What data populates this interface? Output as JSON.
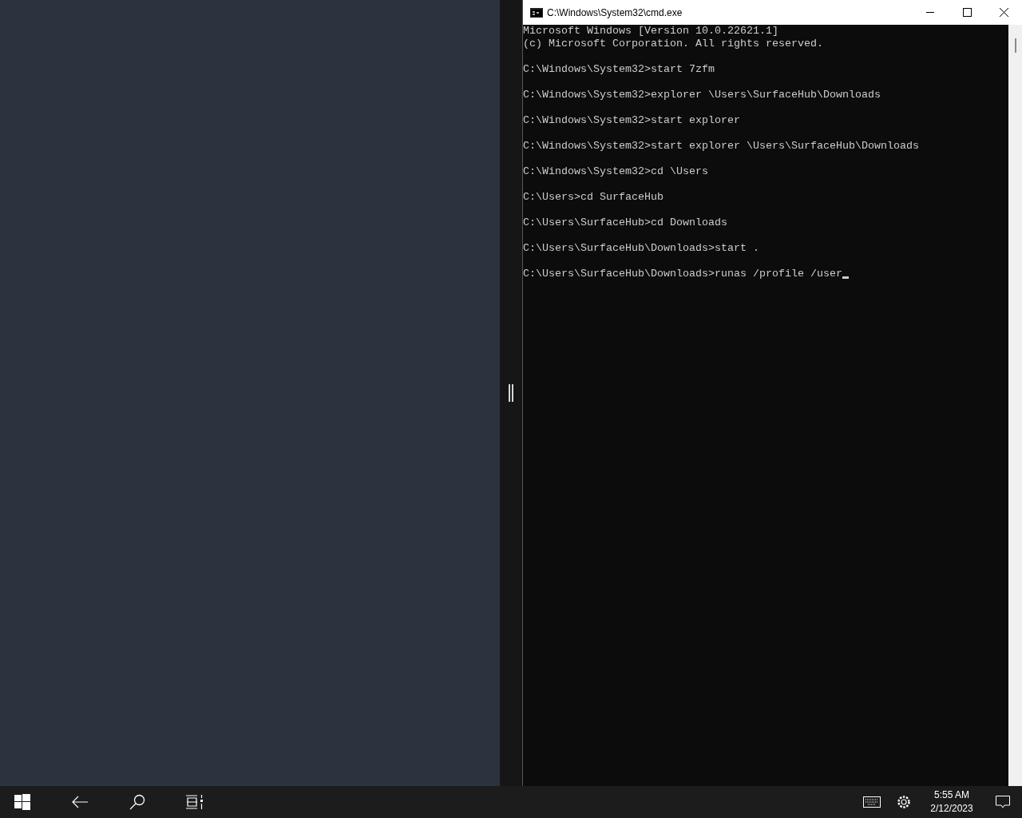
{
  "console_window": {
    "title": "C:\\Windows\\System32\\cmd.exe",
    "blocks": [
      [
        "Microsoft Windows [Version 10.0.22621.1]",
        "(c) Microsoft Corporation. All rights reserved."
      ],
      [
        "C:\\Windows\\System32>start 7zfm"
      ],
      [
        "C:\\Windows\\System32>explorer \\Users\\SurfaceHub\\Downloads"
      ],
      [
        "C:\\Windows\\System32>start explorer"
      ],
      [
        "C:\\Windows\\System32>start explorer \\Users\\SurfaceHub\\Downloads"
      ],
      [
        "C:\\Windows\\System32>cd \\Users"
      ],
      [
        "C:\\Users>cd SurfaceHub"
      ],
      [
        "C:\\Users\\SurfaceHub>cd Downloads"
      ],
      [
        "C:\\Users\\SurfaceHub\\Downloads>start ."
      ],
      [
        "C:\\Users\\SurfaceHub\\Downloads>runas /profile /user"
      ]
    ],
    "cursor": true
  },
  "taskbar": {
    "time": "5:55 AM",
    "date": "2/12/2023"
  }
}
